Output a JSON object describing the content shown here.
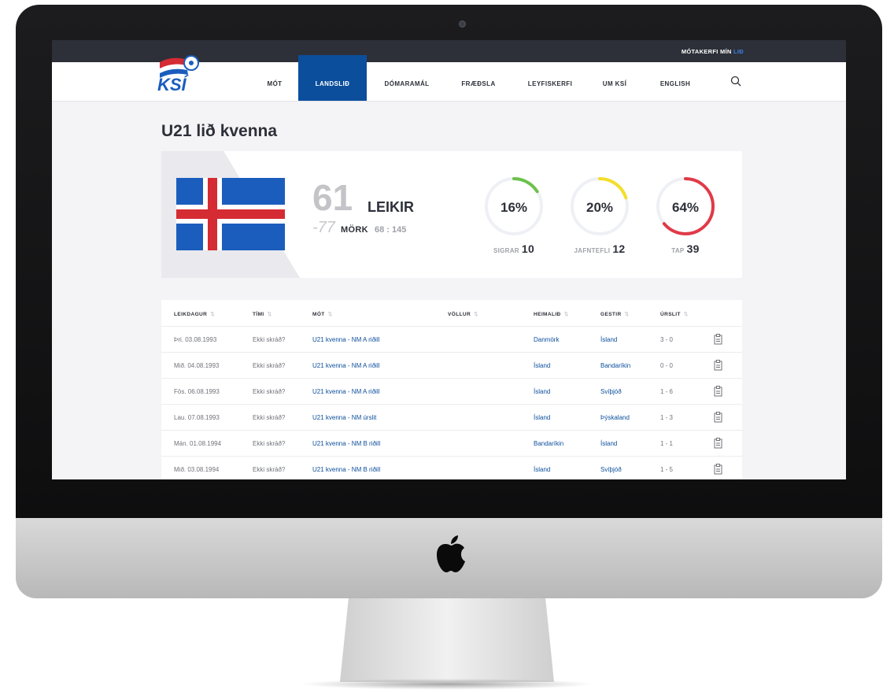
{
  "topbar": {
    "link_prefix": "MÓTAKERFI MÍN",
    "link_suffix": "LIÐ"
  },
  "logo": {
    "text": "KSÍ"
  },
  "nav": {
    "items": [
      {
        "label": "MÓT",
        "active": false
      },
      {
        "label": "LANDSLIÐ",
        "active": true
      },
      {
        "label": "DÓMARAMÁL",
        "active": false
      },
      {
        "label": "FRÆÐSLA",
        "active": false
      },
      {
        "label": "LEYFISKERFI",
        "active": false
      },
      {
        "label": "UM KSÍ",
        "active": false
      },
      {
        "label": "ENGLISH",
        "active": false
      }
    ]
  },
  "page": {
    "title": "U21 lið kvenna"
  },
  "stats": {
    "games": "61",
    "games_label": "LEIKIR",
    "goal_diff": "-77",
    "goals_label": "MÖRK",
    "goals_value": "68 : 145",
    "donuts": [
      {
        "percent": "16%",
        "fraction": 0.16,
        "label": "SIGRAR",
        "count": "10",
        "color": "#6cc24a"
      },
      {
        "percent": "20%",
        "fraction": 0.2,
        "label": "JAFNTEFLI",
        "count": "12",
        "color": "#f3de2c"
      },
      {
        "percent": "64%",
        "fraction": 0.64,
        "label": "TAP",
        "count": "39",
        "color": "#e03a48"
      }
    ],
    "track_color": "#eef0f5"
  },
  "flag_colors": {
    "blue": "#1b5dbd",
    "white": "#ffffff",
    "red": "#d52b33"
  },
  "table": {
    "headers": [
      "LEIKDAGUR",
      "TÍMI",
      "MÓT",
      "VÖLLUR",
      "HEIMALIÐ",
      "GESTIR",
      "ÚRSLIT"
    ],
    "rows": [
      {
        "date": "Þri. 03.08.1993",
        "time": "Ekki skráð?",
        "tournament": "U21 kvenna - NM A riðill",
        "venue": "",
        "home": "Danmörk",
        "away": "Ísland",
        "result": "3 - 0"
      },
      {
        "date": "Mið. 04.08.1993",
        "time": "Ekki skráð?",
        "tournament": "U21 kvenna - NM A riðill",
        "venue": "",
        "home": "Ísland",
        "away": "Bandaríkin",
        "result": "0 - 0"
      },
      {
        "date": "Fös. 06.08.1993",
        "time": "Ekki skráð?",
        "tournament": "U21 kvenna - NM A riðill",
        "venue": "",
        "home": "Ísland",
        "away": "Svíþjóð",
        "result": "1 - 6"
      },
      {
        "date": "Lau. 07.08.1993",
        "time": "Ekki skráð?",
        "tournament": "U21 kvenna - NM úrslit",
        "venue": "",
        "home": "Ísland",
        "away": "Þýskaland",
        "result": "1 - 3"
      },
      {
        "date": "Mán. 01.08.1994",
        "time": "Ekki skráð?",
        "tournament": "U21 kvenna - NM B riðill",
        "venue": "",
        "home": "Bandaríkin",
        "away": "Ísland",
        "result": "1 - 1"
      },
      {
        "date": "Mið. 03.08.1994",
        "time": "Ekki skráð?",
        "tournament": "U21 kvenna - NM B riðill",
        "venue": "",
        "home": "Ísland",
        "away": "Svíþjóð",
        "result": "1 - 5"
      }
    ]
  },
  "icons": {
    "search": "search-icon",
    "report": "report-icon",
    "brand": "apple-logo-icon"
  }
}
